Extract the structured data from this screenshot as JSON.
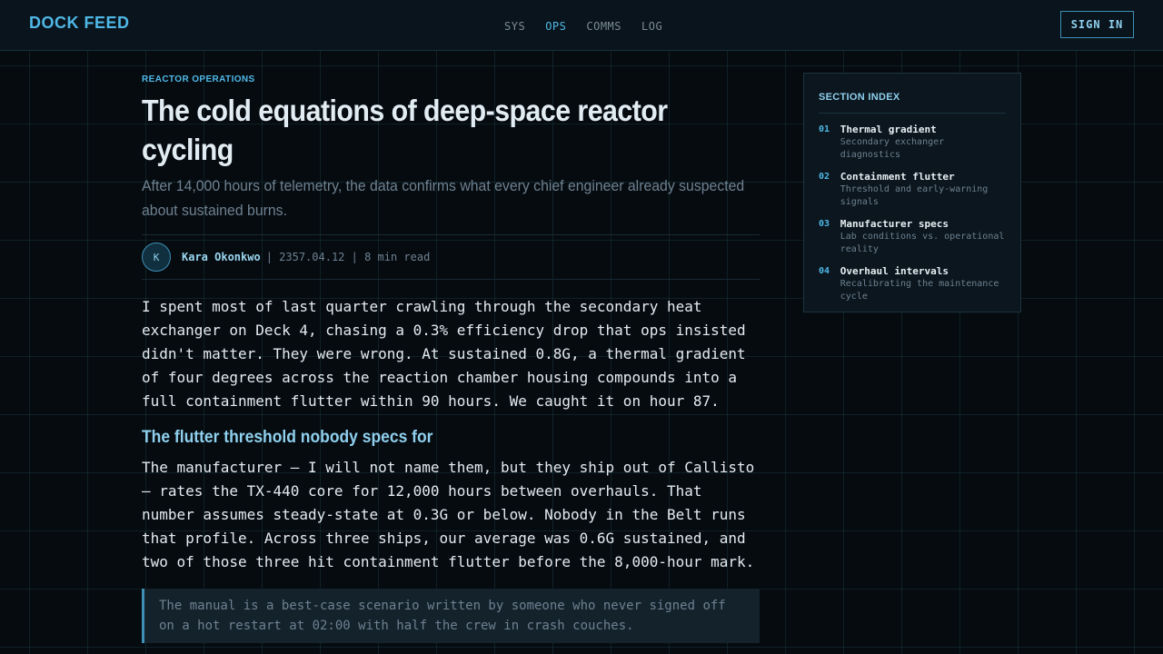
{
  "header": {
    "logo": "DOCK FEED",
    "nav": [
      {
        "label": "SYS",
        "active": false
      },
      {
        "label": "OPS",
        "active": true
      },
      {
        "label": "COMMS",
        "active": false
      },
      {
        "label": "LOG",
        "active": false
      }
    ],
    "sign_in": "SIGN IN"
  },
  "article": {
    "kicker": "REACTOR OPERATIONS",
    "title": "The cold equations of deep-space reactor cycling",
    "dek": "After 14,000 hours of telemetry, the data confirms what every chief engineer already suspected about sustained burns.",
    "byline": {
      "avatar_initial": "K",
      "author": "Kara Okonkwo",
      "meta": "| 2357.04.12 | 8 min read"
    },
    "paragraph_1": "I spent most of last quarter crawling through the secondary heat exchanger on Deck 4, chasing a 0.3% efficiency drop that ops insisted didn't matter. They were wrong. At sustained 0.8G, a thermal gradient of four degrees across the reaction chamber housing compounds into a full containment flutter within 90 hours. We caught it on hour 87.",
    "subhead": "The flutter threshold nobody specs for",
    "paragraph_2": "The manufacturer — I will not name them, but they ship out of Callisto — rates the TX-440 core for 12,000 hours between overhauls. That number assumes steady-state at 0.3G or below. Nobody in the Belt runs that profile. Across three ships, our average was 0.6G sustained, and two of those three hit containment flutter before the 8,000-hour mark.",
    "pullquote": "The manual is a best-case scenario written by someone who never signed off on a hot restart at 02:00 with half the crew in crash couches."
  },
  "toc": {
    "title": "SECTION INDEX",
    "items": [
      {
        "num": "01",
        "label": "Thermal gradient",
        "desc": "Secondary exchanger diagnostics"
      },
      {
        "num": "02",
        "label": "Containment flutter",
        "desc": "Threshold and early-warning signals"
      },
      {
        "num": "03",
        "label": "Manufacturer specs",
        "desc": "Lab conditions vs. operational reality"
      },
      {
        "num": "04",
        "label": "Overhaul intervals",
        "desc": "Recalibrating the maintenance cycle"
      }
    ]
  },
  "colors": {
    "background": "#060b10",
    "accent": "#4fb8e6",
    "text": "#e4ebf0",
    "muted": "#6e8190"
  }
}
